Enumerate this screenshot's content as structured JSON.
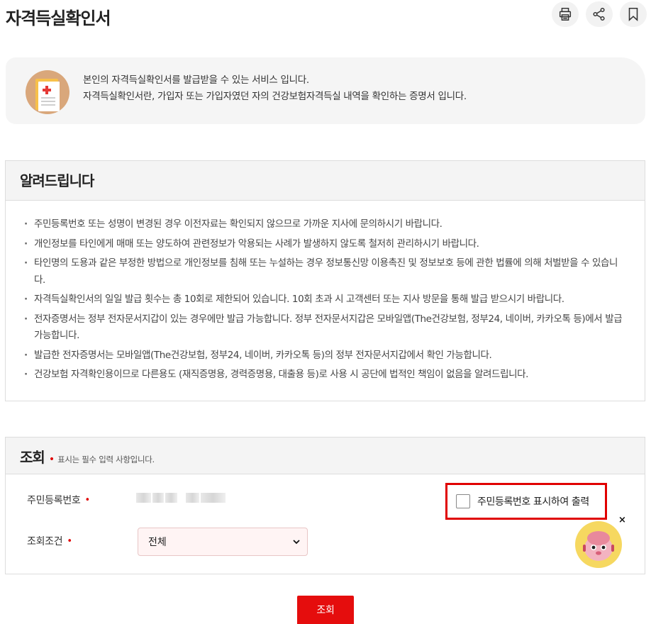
{
  "page": {
    "title": "자격득실확인서"
  },
  "top_actions": [
    {
      "name": "print",
      "icon": "print-icon"
    },
    {
      "name": "share",
      "icon": "share-icon"
    },
    {
      "name": "bookmark",
      "icon": "bookmark-icon"
    }
  ],
  "intro": {
    "icon": "certificate-icon",
    "line1": "본인의 자격득실확인서를 발급받을 수 있는 서비스 입니다.",
    "line2": "자격득실확인서란, 가입자 또는 가입자였던 자의 건강보험자격득실 내역을 확인하는 증명서 입니다."
  },
  "notice": {
    "heading": "알려드립니다",
    "items": [
      "주민등록번호 또는 성명이 변경된 경우 이전자료는 확인되지 않으므로 가까운 지사에 문의하시기 바랍니다.",
      "개인정보를 타인에게 매매 또는 양도하여 관련정보가 악용되는 사례가 발생하지 않도록 철저히 관리하시기 바랍니다.",
      "타인명의 도용과 같은 부정한 방법으로 개인정보를 침해 또는 누설하는 경우 정보통신망 이용촉진 및 정보보호 등에 관한 법률에 의해 처벌받을 수 있습니다.",
      "자격득실확인서의 일일 발급 횟수는 총 10회로 제한되어 있습니다. 10회 초과 시 고객센터 또는 지사 방문을 통해 발급 받으시기 바랍니다.",
      "전자증명서는 정부 전자문서지갑이 있는 경우에만 발급 가능합니다. 정부 전자문서지갑은 모바일앱(The건강보험, 정부24, 네이버, 카카오톡 등)에서 발급 가능합니다.",
      "발급한 전자증명서는 모바일앱(The건강보험, 정부24, 네이버, 카카오톡 등)의 정부 전자문서지갑에서 확인 가능합니다.",
      "건강보험 자격확인용이므로 다른용도 (재직증명용, 경력증명용, 대출용 등)로 사용 시 공단에 법적인 책임이 없음을 알려드립니다."
    ]
  },
  "search": {
    "heading": "조회",
    "required_mark": "•",
    "required_note": "표시는 필수 입력 사항입니다.",
    "rrn_label": "주민등록번호",
    "rrn_checkbox_label": "주민등록번호 표시하여 출력",
    "rrn_checkbox_checked": false,
    "condition_label": "조회조건",
    "condition_selected": "전체",
    "submit_label": "조회"
  },
  "chatbot": {
    "icon": "chatbot-mascot-icon",
    "close_label": "×"
  },
  "colors": {
    "accent": "#e50d0d",
    "panel_bg": "#f4f4f4"
  }
}
